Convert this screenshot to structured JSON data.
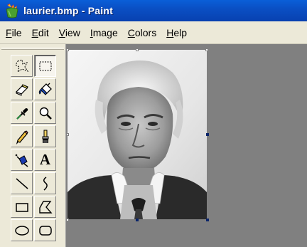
{
  "window": {
    "title": "laurier.bmp - Paint"
  },
  "menu": [
    {
      "name": "file",
      "label": "File",
      "underline": "F",
      "rest": "ile"
    },
    {
      "name": "edit",
      "label": "Edit",
      "underline": "E",
      "rest": "dit"
    },
    {
      "name": "view",
      "label": "View",
      "underline": "V",
      "rest": "iew"
    },
    {
      "name": "image",
      "label": "Image",
      "underline": "I",
      "rest": "mage"
    },
    {
      "name": "colors",
      "label": "Colors",
      "underline": "C",
      "rest": "olors"
    },
    {
      "name": "help",
      "label": "Help",
      "underline": "H",
      "rest": "elp"
    }
  ],
  "tools": [
    {
      "name": "free-form-select",
      "icon": "free-form-select-icon"
    },
    {
      "name": "select",
      "icon": "rect-select-icon",
      "selected": true
    },
    {
      "name": "eraser",
      "icon": "eraser-icon"
    },
    {
      "name": "fill-with-color",
      "icon": "paint-bucket-icon"
    },
    {
      "name": "pick-color",
      "icon": "eyedropper-icon"
    },
    {
      "name": "magnifier",
      "icon": "magnifier-icon"
    },
    {
      "name": "pencil",
      "icon": "pencil-icon"
    },
    {
      "name": "brush",
      "icon": "brush-icon"
    },
    {
      "name": "airbrush",
      "icon": "airbrush-icon"
    },
    {
      "name": "text",
      "icon": "text-icon",
      "glyph": "A"
    },
    {
      "name": "line",
      "icon": "line-icon"
    },
    {
      "name": "curve",
      "icon": "curve-icon"
    },
    {
      "name": "rectangle",
      "icon": "rectangle-icon"
    },
    {
      "name": "polygon",
      "icon": "polygon-icon"
    },
    {
      "name": "ellipse",
      "icon": "ellipse-icon"
    },
    {
      "name": "rounded-rectangle",
      "icon": "rounded-rectangle-icon"
    }
  ],
  "colors": {
    "titlebar": "#0a4fc4",
    "workspace": "#808080",
    "toolbox": "#ece9d8"
  }
}
